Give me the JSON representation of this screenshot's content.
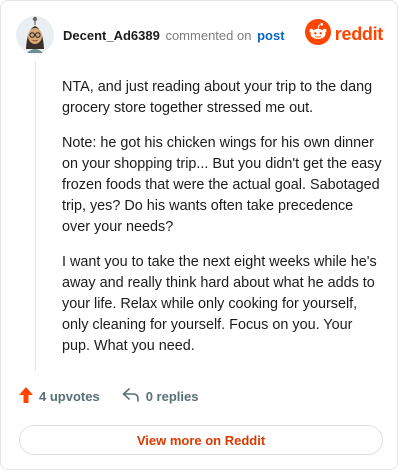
{
  "comment": {
    "author": "Decent_Ad6389",
    "action_text": "commented on",
    "target_text": "post",
    "paragraphs": [
      "NTA, and just reading about your trip to the dang grocery store together stressed me out.",
      "Note: he got his chicken wings for his own dinner on your shopping trip... But you didn't get the easy frozen foods that were the actual goal. Sabotaged trip, yes? Do his wants often take precedence over your needs?",
      "I want you to take the next eight weeks while he's away and really think hard about what he adds to your life. Relax while only cooking for yourself, only cleaning for yourself. Focus on you. Your pup. What you need."
    ],
    "upvotes_label": "4 upvotes",
    "replies_label": "0 replies"
  },
  "brand": {
    "name": "reddit",
    "color": "#ff4500"
  },
  "footer": {
    "view_more_label": "View more on Reddit"
  },
  "icons": {
    "avatar": "avatar-icon",
    "logo": "reddit-logo-icon",
    "upvote": "upvote-arrow-icon",
    "reply": "reply-arrow-icon"
  }
}
